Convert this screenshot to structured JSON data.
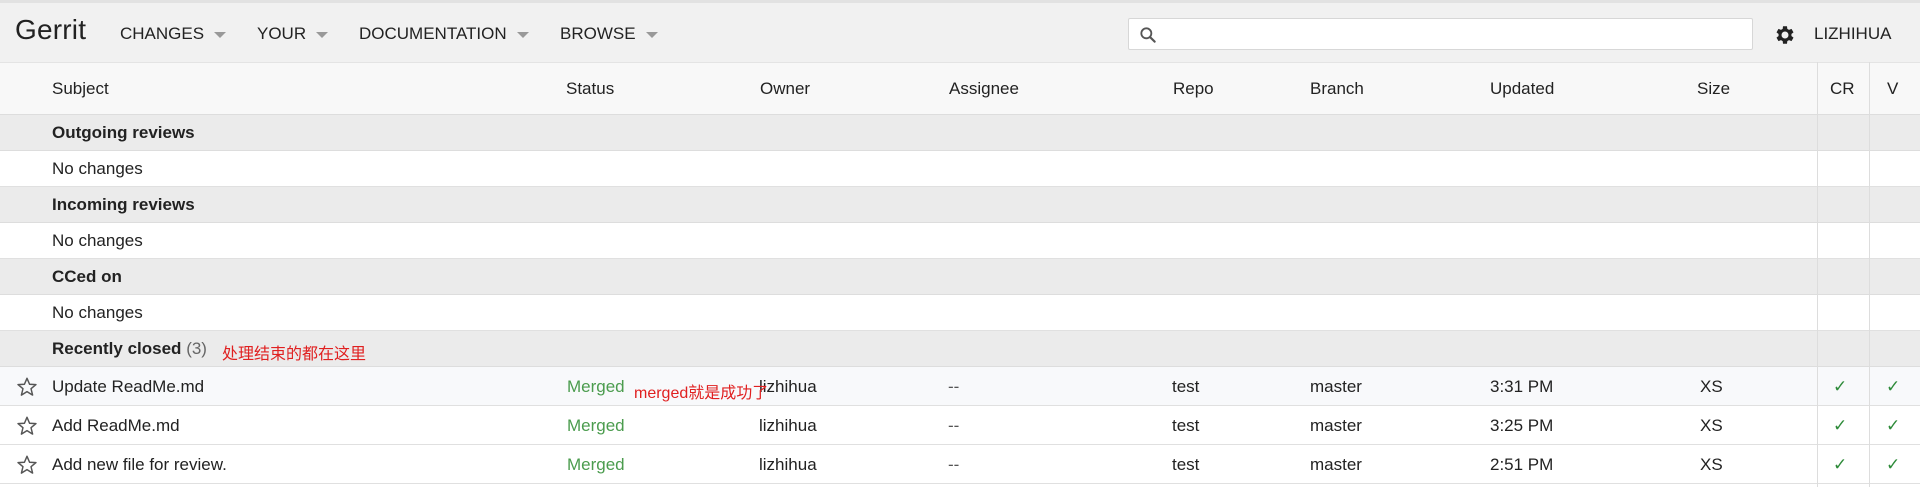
{
  "header": {
    "brand": "Gerrit",
    "nav": [
      "CHANGES",
      "YOUR",
      "DOCUMENTATION",
      "BROWSE"
    ],
    "search_placeholder": "",
    "account": "LIZHIHUA"
  },
  "columns": [
    "Subject",
    "Status",
    "Owner",
    "Assignee",
    "Repo",
    "Branch",
    "Updated",
    "Size",
    "CR",
    "V"
  ],
  "sections": {
    "outgoing": {
      "title": "Outgoing reviews",
      "empty": "No changes"
    },
    "incoming": {
      "title": "Incoming reviews",
      "empty": "No changes"
    },
    "cced": {
      "title": "CCed on",
      "empty": "No changes"
    },
    "closed": {
      "title": "Recently closed",
      "count": "(3)",
      "annotation": "处理结束的都在这里"
    }
  },
  "changes": [
    {
      "subject": "Update ReadMe.md",
      "status": "Merged",
      "owner": "lizhihua",
      "assignee": "--",
      "repo": "test",
      "branch": "master",
      "updated": "3:31 PM",
      "size": "XS",
      "cr": "✓",
      "v": "✓"
    },
    {
      "subject": "Add ReadMe.md",
      "status": "Merged",
      "owner": "lizhihua",
      "assignee": "--",
      "repo": "test",
      "branch": "master",
      "updated": "3:25 PM",
      "size": "XS",
      "cr": "✓",
      "v": "✓"
    },
    {
      "subject": "Add new file for review.",
      "status": "Merged",
      "owner": "lizhihua",
      "assignee": "--",
      "repo": "test",
      "branch": "master",
      "updated": "2:51 PM",
      "size": "XS",
      "cr": "✓",
      "v": "✓"
    }
  ],
  "row_annotation": "merged就是成功了",
  "colors": {
    "merged": "#4b9c4e",
    "annotation": "#e02020",
    "header_bg": "#f1f1f1"
  }
}
